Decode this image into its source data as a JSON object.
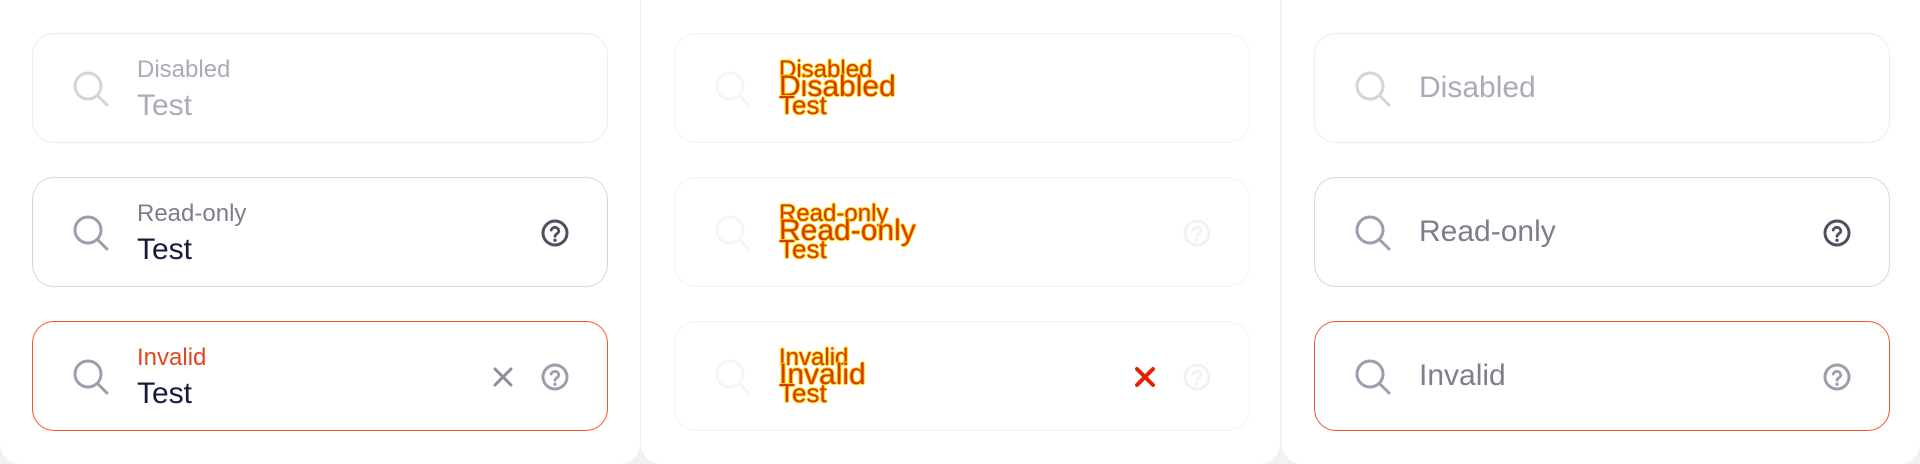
{
  "columns": [
    {
      "fields": [
        {
          "label": "Disabled",
          "value": "Test"
        },
        {
          "label": "Read-only",
          "value": "Test"
        },
        {
          "label": "Invalid",
          "value": "Test"
        }
      ]
    },
    {
      "fields": [
        {
          "label": "Disabled",
          "value": "Test"
        },
        {
          "label": "Read-only",
          "value": "Test"
        },
        {
          "label": "Invalid",
          "value": "Test"
        }
      ]
    },
    {
      "fields": [
        {
          "label": "Disabled"
        },
        {
          "label": "Read-only"
        },
        {
          "label": "Invalid"
        }
      ]
    }
  ],
  "icons": {
    "search": "search-icon",
    "help": "help-circle-icon",
    "clear": "close-icon"
  },
  "colors": {
    "invalid_border": "#f0572c",
    "invalid_label": "#e0461f",
    "text_dark": "#161a3a",
    "text_muted": "#7c7e8c",
    "glitch_red": "#d93a00",
    "glitch_yellow": "#ffd400"
  }
}
